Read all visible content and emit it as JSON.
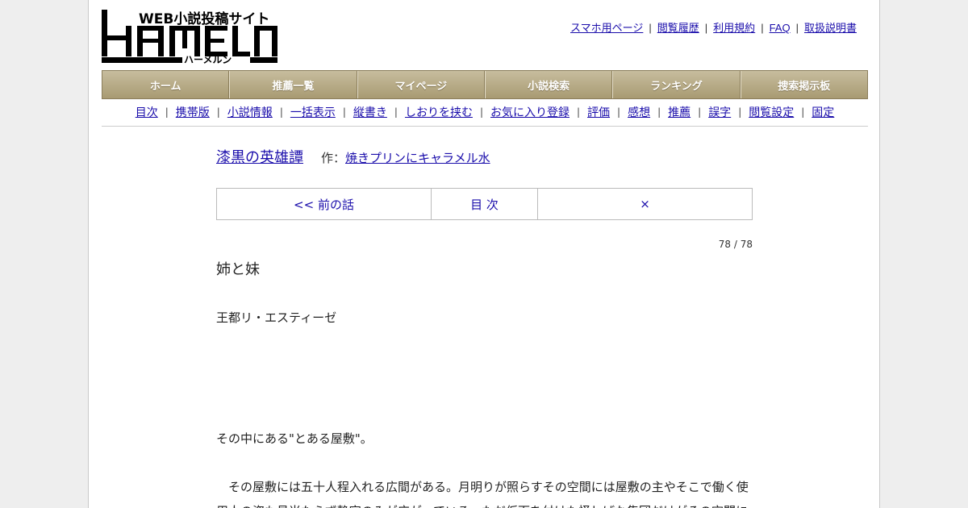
{
  "logo": {
    "text": "HAMELN",
    "tagline": "WEB小説投稿サイト",
    "kana": "ハーメルン"
  },
  "toplinks": [
    "スマホ用ページ",
    "閲覧履歴",
    "利用規約",
    "FAQ",
    "取扱説明書"
  ],
  "mainnav": [
    "ホーム",
    "推薦一覧",
    "マイページ",
    "小説検索",
    "ランキング",
    "捜索掲示板"
  ],
  "subnav": [
    "目次",
    "携帯版",
    "小説情報",
    "一括表示",
    "縦書き",
    "しおりを挟む",
    "お気に入り登録",
    "評価",
    "感想",
    "推薦",
    "誤字",
    "閲覧設定",
    "固定"
  ],
  "novel": {
    "title": "漆黒の英雄譚",
    "author_prefix": "作：",
    "author": "焼きプリンにキャラメル水"
  },
  "pager": {
    "prev": "<< 前の話",
    "toc": "目 次",
    "next": "×"
  },
  "pagecount": "78 / 78",
  "chapter_title": "姉と妹",
  "paragraphs": [
    "王都リ・エスティーゼ",
    "",
    "",
    "",
    "",
    "その中にある\"とある屋敷\"。",
    "",
    "　その屋敷には五十人程入れる広間がある。月明りが照らすその空間には屋敷の主やそこで働く使",
    "用人の姿も見当たらず静寂のみが広がっている。ただ仮面を付けた怪しげな集団だけがその空間に"
  ],
  "colors": {
    "link": "#1a0dab",
    "nav_bg": "#b3a784",
    "page_bg": "#eeeeee"
  }
}
